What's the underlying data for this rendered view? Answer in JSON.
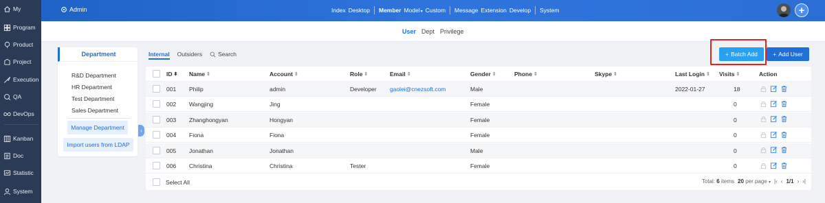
{
  "sidebar": {
    "items": [
      {
        "label": "My",
        "icon": "home-icon"
      },
      {
        "label": "Program",
        "icon": "program-icon"
      },
      {
        "label": "Product",
        "icon": "product-icon"
      },
      {
        "label": "Project",
        "icon": "project-icon"
      },
      {
        "label": "Execution",
        "icon": "execution-icon"
      },
      {
        "label": "QA",
        "icon": "qa-icon"
      },
      {
        "label": "DevOps",
        "icon": "devops-icon"
      },
      {
        "label": "Kanban",
        "icon": "kanban-icon"
      },
      {
        "label": "Doc",
        "icon": "doc-icon"
      },
      {
        "label": "Statistic",
        "icon": "statistic-icon"
      },
      {
        "label": "System",
        "icon": "system-icon"
      }
    ]
  },
  "header": {
    "admin_label": "Admin",
    "menu": [
      "Index",
      "Desktop",
      "Member",
      "Model",
      "Custom",
      "Message",
      "Extension",
      "Develop",
      "System"
    ],
    "active_menu": "Member"
  },
  "subnav": {
    "tabs": [
      "User",
      "Dept",
      "Privilege"
    ],
    "active": "User"
  },
  "department": {
    "title": "Department",
    "items": [
      "R&D Department",
      "HR Department",
      "Test Department",
      "Sales Department"
    ],
    "manage_label": "Manage Department",
    "ldap_label": "Import users from LDAP"
  },
  "toolbar": {
    "tabs": [
      "Internal",
      "Outsiders"
    ],
    "search_label": "Search",
    "batch_add_label": "Batch Add",
    "add_user_label": "Add User"
  },
  "table": {
    "columns": [
      "ID",
      "Name",
      "Account",
      "Role",
      "Email",
      "Gender",
      "Phone",
      "Skype",
      "Last Login",
      "Visits",
      "Action"
    ],
    "rows": [
      {
        "id": "001",
        "name": "Philip",
        "account": "admin",
        "role": "Developer",
        "email": "gaolei@cnezsoft.com",
        "gender": "Male",
        "phone": "",
        "skype": "",
        "last_login": "2022-01-27",
        "visits": "18"
      },
      {
        "id": "002",
        "name": "Wangjing",
        "account": "Jing",
        "role": "",
        "email": "",
        "gender": "Female",
        "phone": "",
        "skype": "",
        "last_login": "",
        "visits": "0"
      },
      {
        "id": "003",
        "name": "Zhanghongyan",
        "account": "Hongyan",
        "role": "",
        "email": "",
        "gender": "Female",
        "phone": "",
        "skype": "",
        "last_login": "",
        "visits": "0"
      },
      {
        "id": "004",
        "name": "Fiona",
        "account": "Fiona",
        "role": "",
        "email": "",
        "gender": "Female",
        "phone": "",
        "skype": "",
        "last_login": "",
        "visits": "0"
      },
      {
        "id": "005",
        "name": "Jonathan",
        "account": "Jonathan",
        "role": "",
        "email": "",
        "gender": "Male",
        "phone": "",
        "skype": "",
        "last_login": "",
        "visits": "0"
      },
      {
        "id": "006",
        "name": "Christina",
        "account": "Christina",
        "role": "Tester",
        "email": "",
        "gender": "Female",
        "phone": "",
        "skype": "",
        "last_login": "",
        "visits": "0"
      }
    ],
    "select_all_label": "Select All",
    "pager": {
      "total_prefix": "Total:",
      "total": "6",
      "total_suffix": "items",
      "per_page": "20",
      "per_page_suffix": "per page",
      "page": "1/1"
    }
  },
  "colors": {
    "sidebar": "#2b3a55",
    "header": "#2b6fd6",
    "accent": "#1f6fd6",
    "batch_button": "#2aa0f0",
    "highlight_box": "#e0271f"
  }
}
